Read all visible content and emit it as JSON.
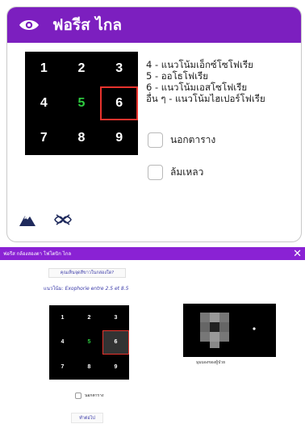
{
  "card": {
    "title": "ฟอรีส ไกล",
    "grid": [
      "1",
      "2",
      "3",
      "4",
      "5",
      "6",
      "7",
      "8",
      "9"
    ],
    "selected_cell": "6",
    "green_cell": "5",
    "legend": [
      "4 - แนวโน้มเอ็กซ์โซโฟเรีย",
      "5 - ออโธโฟเรีย",
      "6 - แนวโน้มเอสโซโฟเรีย",
      "อื่น ๆ - แนวโน้มไฮเปอร์โฟเรีย"
    ],
    "checkbox_outside": "นอกตาราง",
    "checkbox_fail": "ล้มเหลว",
    "colors": {
      "header": "#7c1fbf",
      "selected_border": "#e8332d",
      "green": "#2ecc40"
    },
    "icons": [
      "mountain-icon",
      "crossed-eyes-icon"
    ]
  },
  "dialog": {
    "title": "ฟอรีส กล้องสองตา โฟโตบิก ไกล",
    "close": "✕",
    "link_button": "คุณเห็นจุดสีขาวในกล่องใด?",
    "recommend_label": "แนวโน้ม:",
    "recommend_value": "Exophorie entre 2.5 et 8.5",
    "grid": [
      "1",
      "2",
      "3",
      "4",
      "5",
      "6",
      "7",
      "8",
      "9"
    ],
    "caption": "มุมมองของผู้ป่วย",
    "checkbox_outside": "นอกตาราง",
    "continue": "ทำต่อไป"
  }
}
